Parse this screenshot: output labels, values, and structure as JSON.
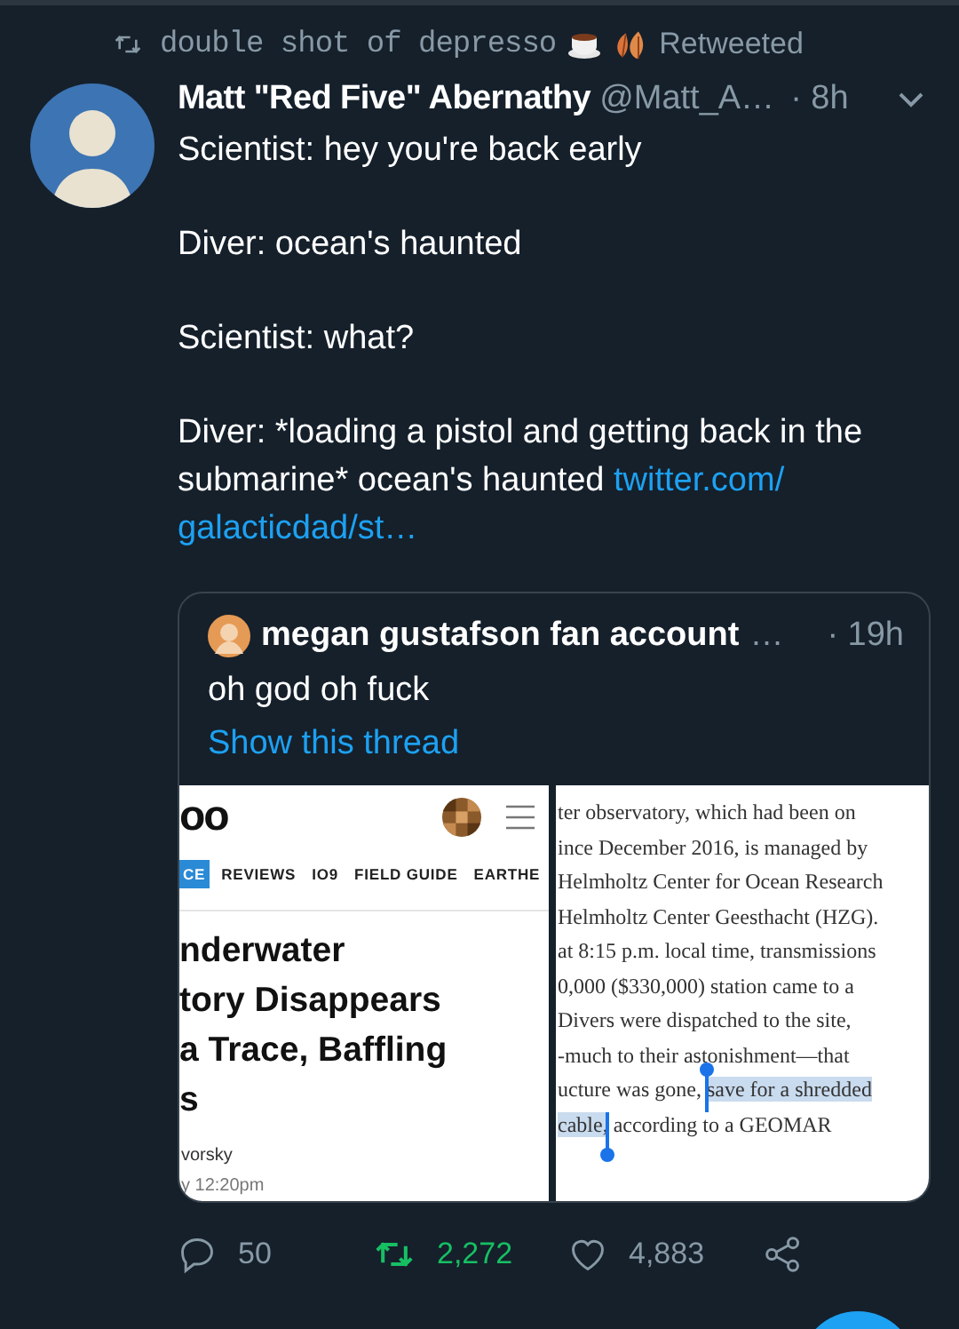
{
  "retweet_banner": {
    "retweeter": "double shot of depresso",
    "label": "Retweeted"
  },
  "tweet": {
    "author": "Matt \"Red Five\" Abernathy",
    "handle": "@Matt_A…",
    "time": "· 8h",
    "paragraphs": [
      "Scientist: hey you're back early",
      "Diver: ocean's haunted",
      "Scientist: what?",
      "Diver: *loading a pistol and getting back in the submarine* ocean's haunted"
    ],
    "link_lines": [
      "twitter.com/",
      "galacticdad/st…"
    ]
  },
  "quoted_tweet": {
    "author": "megan gustafson fan account",
    "ellipsis": "…",
    "time": "· 19h",
    "text": "oh god oh fuck",
    "thread_link": "Show this thread",
    "article_left": {
      "logo": "oo",
      "nav": [
        {
          "label": "CE",
          "selected": true
        },
        {
          "label": "REVIEWS",
          "selected": false
        },
        {
          "label": "IO9",
          "selected": false
        },
        {
          "label": "FIELD GUIDE",
          "selected": false
        },
        {
          "label": "EARTHE",
          "selected": false
        }
      ],
      "headline_lines": [
        "nderwater",
        "tory Disappears",
        "a Trace, Baffling",
        "s"
      ],
      "byline": "vorsky",
      "date": "y 12:20pm"
    },
    "article_right": {
      "lines": [
        [
          {
            "text": "ter observatory, which had been on",
            "selected": false
          }
        ],
        [
          {
            "text": "ince December 2016, is managed by",
            "selected": false
          }
        ],
        [
          {
            "text": "Helmholtz Center for Ocean Research",
            "selected": false
          }
        ],
        [
          {
            "text": "Helmholtz Center Geesthacht (HZG).",
            "selected": false
          }
        ],
        [
          {
            "text": "at 8:15 p.m. local time, transmissions",
            "selected": false
          }
        ],
        [
          {
            "text": "0,000 ($330,000) station came to a",
            "selected": false
          }
        ],
        [
          {
            "text": "Divers were dispatched to the site,",
            "selected": false
          }
        ],
        [
          {
            "text": "-much to their astonishment—that",
            "selected": false
          }
        ],
        [
          {
            "text": "ucture was gone, ",
            "selected": false
          },
          {
            "text": "save for a shredded",
            "selected": true
          }
        ],
        [
          {
            "text": "cable,",
            "selected": true
          },
          {
            "text": " according to a GEOMAR",
            "selected": false
          }
        ]
      ]
    }
  },
  "actions": {
    "replies": "50",
    "retweets": "2,272",
    "retweeted": true,
    "likes": "4,883",
    "liked": false
  }
}
